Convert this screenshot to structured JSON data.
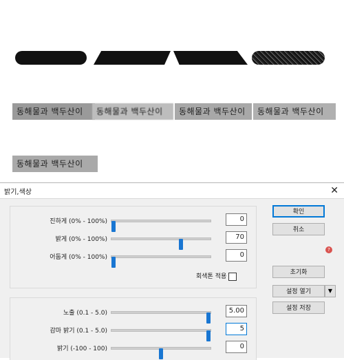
{
  "samples": {
    "text": [
      "동해물과 백두산이",
      "동해물과 백두산이",
      "동해물과 백두산이",
      "동해물과 백두산이",
      "동해물과 백두산이"
    ]
  },
  "dialog": {
    "title": "밝기,색상",
    "close_glyph": "✕",
    "sliders_a": [
      {
        "label": "진하게 (0% - 100%)",
        "value": "0",
        "level": 0.02
      },
      {
        "label": "밝게 (0% - 100%)",
        "value": "70",
        "level": 0.7
      },
      {
        "label": "어둡게 (0% - 100%)",
        "value": "0",
        "level": 0.02
      }
    ],
    "grayscale_label": "회색톤 적용",
    "sliders_b": [
      {
        "label": "노출 (0.1 - 5.0)",
        "value": "5.00",
        "level": 0.98
      },
      {
        "label": "감마 밝기 (0.1 - 5.0)",
        "value": "5",
        "level": 0.98
      },
      {
        "label": "밝기 (-100 - 100)",
        "value": "0",
        "level": 0.5
      }
    ],
    "buttons": {
      "ok": "확인",
      "cancel": "취소",
      "reset": "초기화",
      "open_settings": "설정 열기",
      "save_settings": "설정 저장"
    },
    "help_glyph": "?",
    "dropdown_glyph": "▼"
  }
}
